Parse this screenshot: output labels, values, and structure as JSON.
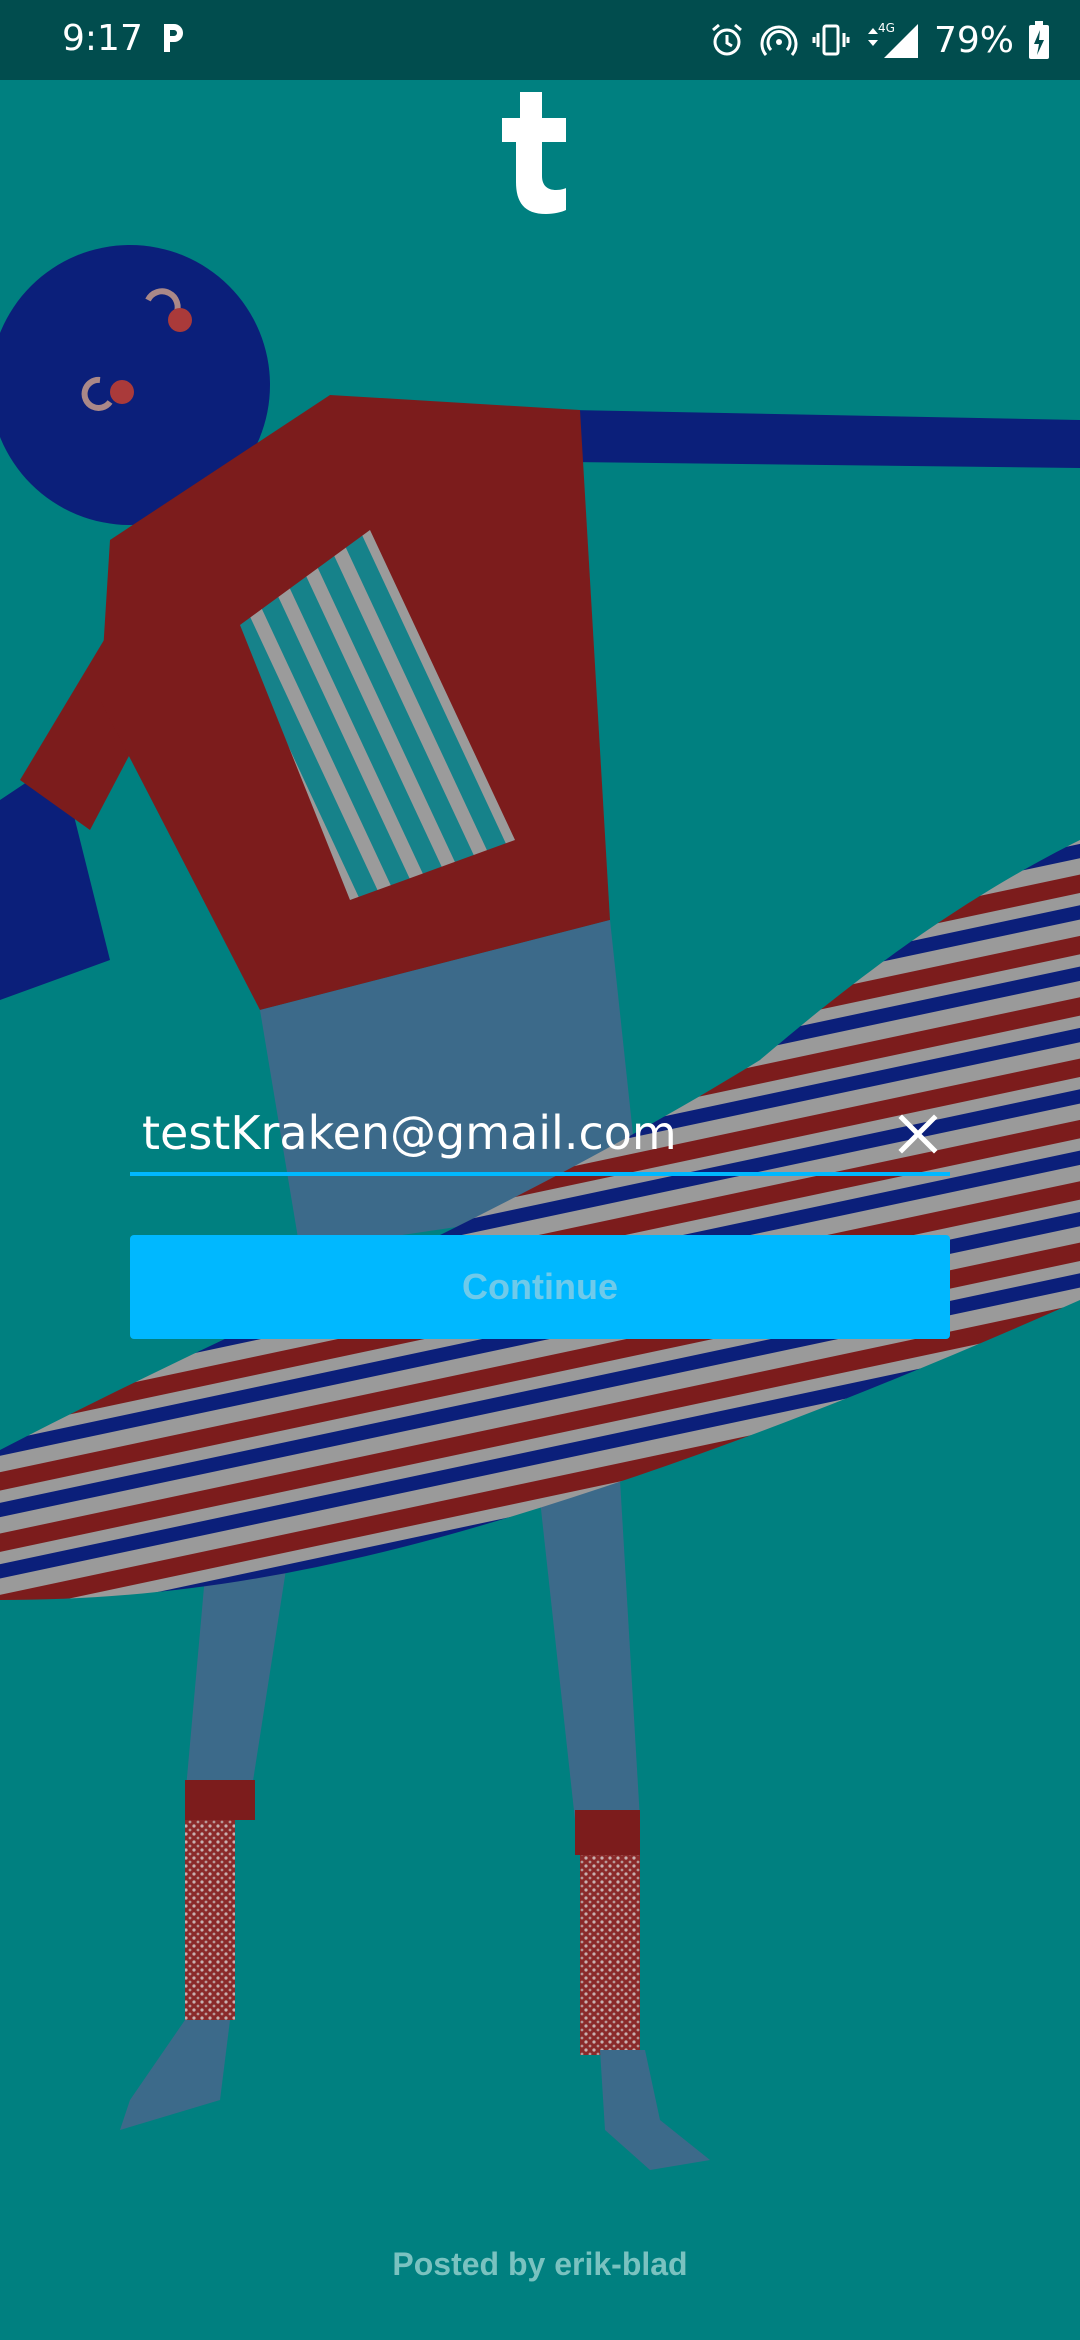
{
  "status_bar": {
    "time": "9:17",
    "battery": "79%",
    "network": "4G",
    "icons": [
      "parking-app-icon",
      "alarm-icon",
      "hotspot-icon",
      "vibrate-icon",
      "signal-icon",
      "battery-charging-icon"
    ]
  },
  "app": {
    "logo_icon": "tumblr-logo-icon"
  },
  "login": {
    "email_value": "testKraken@gmail.com",
    "clear_icon": "close-icon",
    "continue_label": "Continue"
  },
  "footer": {
    "posted_by": "Posted by erik-blad"
  },
  "colors": {
    "background": "#008080",
    "status_bar": "#014d4e",
    "accent": "#00b8ff",
    "button_text": "#6fcaea",
    "footer_text": "#7ac2c0"
  }
}
